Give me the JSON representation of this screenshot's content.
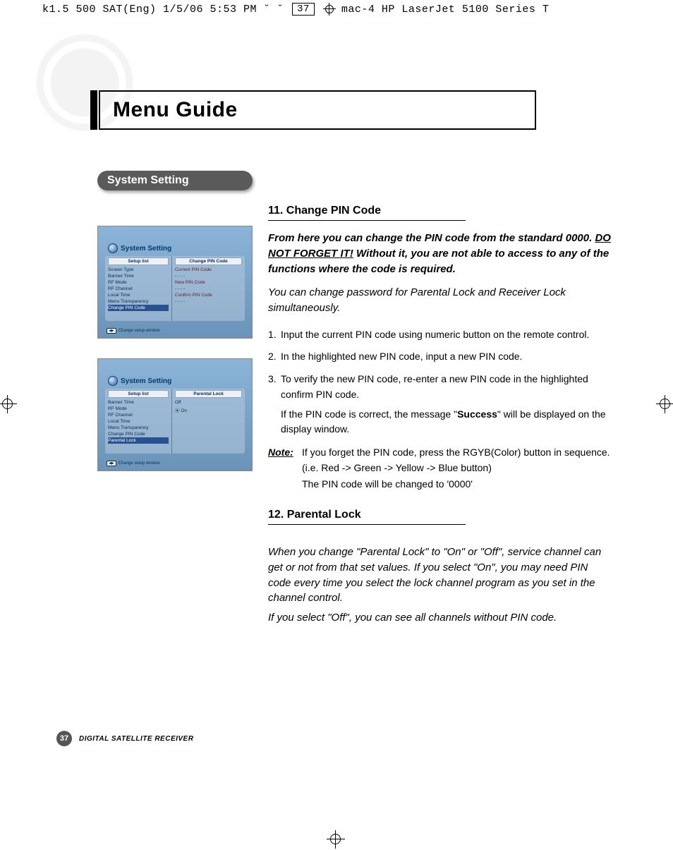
{
  "print_header": {
    "left": "k1.5 500 SAT(Eng)  1/5/06 5:53 PM  ˘    ˘",
    "page_num": "37",
    "right": "mac-4 HP LaserJet 5100 Series  T"
  },
  "title": "Menu Guide",
  "section_pill": "System Setting",
  "screenshot1": {
    "title": "System Setting",
    "left_header": "Setup list",
    "right_header": "Change PIN Code",
    "left_items": [
      "Screen Type",
      "Banner Time",
      "RF Mode",
      "RF Channel",
      "Local Time",
      "Menu Transparency",
      "Change PIN Code"
    ],
    "right_items": [
      "Current PIN Code",
      "- - - -",
      "New PIN Code",
      "- - - -",
      "Confirm PIN Code",
      "- - - -"
    ],
    "footer_key": "◀▶",
    "footer_text": "Change setup window"
  },
  "screenshot2": {
    "title": "System Setting",
    "left_header": "Setup list",
    "right_header": "Parental Lock",
    "left_items": [
      "Banner Time",
      "RF Mode",
      "RF Channel",
      "Local Time",
      "Menu Transparency",
      "Change PIN Code",
      "Parental Lock"
    ],
    "right_items": [
      "Off",
      "⦿ On"
    ],
    "footer_key": "◀▶",
    "footer_text": "Change setup window"
  },
  "sec11": {
    "heading": "11. Change PIN Code",
    "intro_bold_pre": "From here you can change the PIN code from the standard 0000. ",
    "intro_warn": "DO NOT FORGET IT!",
    "intro_bold_post": " Without it, you are not able to access to any of the functions where the code is required.",
    "intro2": "You can change password for Parental Lock and Receiver Lock simultaneously.",
    "step1": "Input the current PIN code using numeric button on the remote control.",
    "step2": "In the highlighted new PIN code, input a new PIN code.",
    "step3": "To verify the new PIN code, re-enter a new PIN code in the highlighted confirm PIN code.",
    "step3b_pre": "If the PIN code is correct, the message \"",
    "step3b_bold": "Success",
    "step3b_post": "\" will be displayed on the display window.",
    "note_label": "Note:",
    "note_line1": "If you forget the PIN code, press the RGYB(Color) button in sequence.",
    "note_line2": "(i.e. Red -> Green -> Yellow -> Blue button)",
    "note_line3": "The PIN code will be changed to '0000'"
  },
  "sec12": {
    "heading": "12. Parental Lock",
    "p1": "When you change \"Parental Lock\" to \"On\" or \"Off\", service channel can get or not from that set values. If you select \"On\", you may need PIN code every time you select the lock channel program as you set in the channel control.",
    "p2": "If you select \"Off\", you can see all channels without PIN code."
  },
  "footer": {
    "page": "37",
    "text": "DIGITAL SATELLITE RECEIVER"
  }
}
